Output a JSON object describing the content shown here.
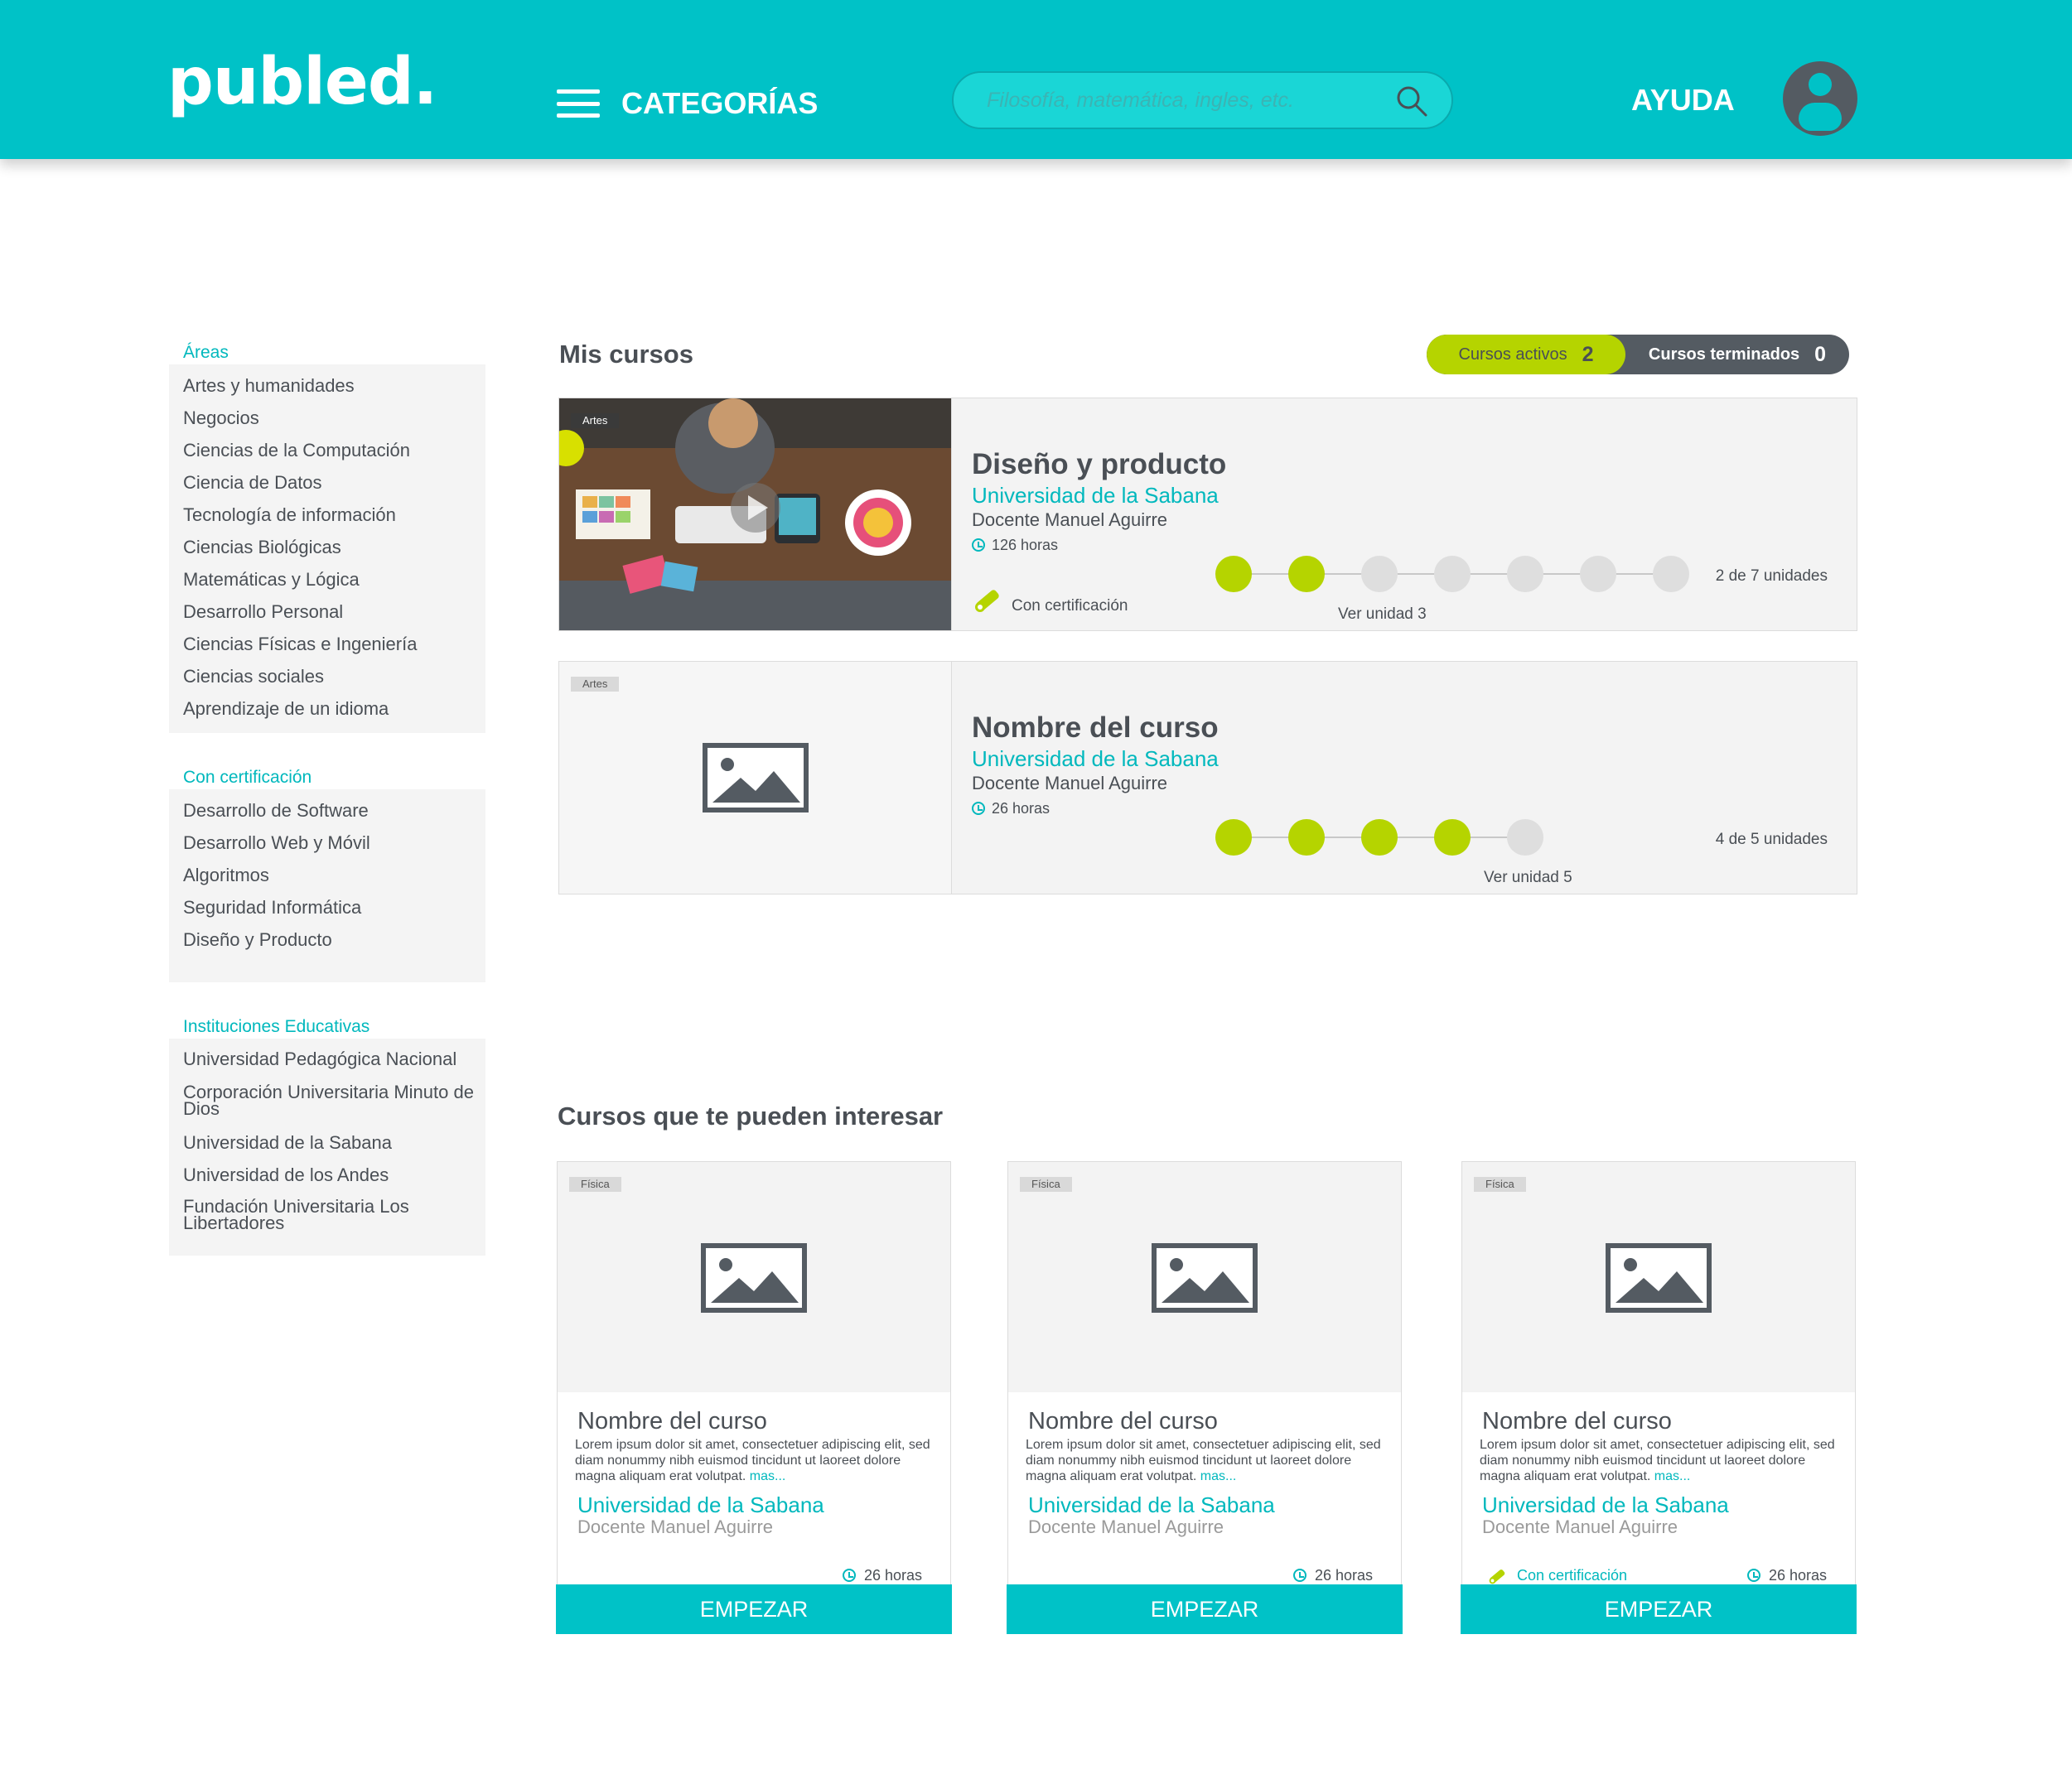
{
  "header": {
    "logo": "publed.",
    "menu_label": "CATEGORÍAS",
    "search_placeholder": "Filosofía, matemática, ingles, etc.",
    "help_label": "AYUDA"
  },
  "sidebar": {
    "groups": [
      {
        "title": "Áreas",
        "items": [
          "Artes y humanidades",
          "Negocios",
          "Ciencias de la Computación",
          "Ciencia de Datos",
          "Tecnología de información",
          "Ciencias Biológicas",
          "Matemáticas y Lógica",
          "Desarrollo Personal",
          "Ciencias Físicas e Ingeniería",
          "Ciencias sociales",
          "Aprendizaje de un idioma"
        ]
      },
      {
        "title": "Con certificación",
        "items": [
          "Desarrollo de Software",
          "Desarrollo Web y Móvil",
          "Algoritmos",
          "Seguridad Informática",
          "Diseño y Producto"
        ]
      },
      {
        "title": "Instituciones Educativas",
        "items": [
          "Universidad Pedagógica Nacional",
          "Corporación Universitaria Minuto de Dios",
          "Universidad de la Sabana",
          "Universidad de los Andes",
          "Fundación Universitaria Los Libertadores"
        ]
      }
    ]
  },
  "my_courses": {
    "title": "Mis cursos",
    "active_label": "Cursos activos",
    "active_count": "2",
    "done_label": "Cursos terminados",
    "done_count": "0",
    "courses": [
      {
        "tag": "Artes",
        "name": "Diseño y producto",
        "university": "Universidad de la Sabana",
        "teacher": "Docente Manuel Aguirre",
        "hours": "126 horas",
        "certification": "Con certificación",
        "progress": {
          "completed": 2,
          "total": 7
        },
        "units_text": "2 de 7 unidades",
        "next_unit": "Ver unidad 3"
      },
      {
        "tag": "Artes",
        "name": "Nombre del curso",
        "university": "Universidad de la Sabana",
        "teacher": "Docente Manuel Aguirre",
        "hours": "26 horas",
        "progress": {
          "completed": 4,
          "total": 5
        },
        "units_text": "4 de 5 unidades",
        "next_unit": "Ver unidad 5"
      }
    ]
  },
  "recommended": {
    "title": "Cursos que te pueden interesar",
    "cards": [
      {
        "tag": "Física",
        "name": "Nombre del curso",
        "description": "Lorem ipsum dolor sit amet, consectetuer adipiscing elit, sed diam nonummy nibh euismod tincidunt ut laoreet dolore magna aliquam erat volutpat.",
        "more": "mas...",
        "university": "Universidad de la Sabana",
        "teacher": "Docente Manuel Aguirre",
        "hours": "26 horas",
        "button": "EMPEZAR"
      },
      {
        "tag": "Física",
        "name": "Nombre del curso",
        "description": "Lorem ipsum dolor sit amet, consectetuer adipiscing elit, sed diam nonummy nibh euismod tincidunt ut laoreet dolore magna aliquam erat volutpat.",
        "more": "mas...",
        "university": "Universidad de la Sabana",
        "teacher": "Docente Manuel Aguirre",
        "hours": "26 horas",
        "button": "EMPEZAR"
      },
      {
        "tag": "Física",
        "name": "Nombre del curso",
        "description": "Lorem ipsum dolor sit amet, consectetuer adipiscing elit, sed diam nonummy nibh euismod tincidunt ut laoreet dolore magna aliquam erat volutpat.",
        "more": "mas...",
        "university": "Universidad de la Sabana",
        "teacher": "Docente Manuel Aguirre",
        "certification": "Con certificación",
        "hours": "26 horas",
        "button": "EMPEZAR"
      }
    ]
  },
  "colors": {
    "primary": "#00c2c7",
    "accent": "#b5d400",
    "dark": "#545b62",
    "text": "#4a4f55"
  },
  "icons": {
    "menu": "hamburger-icon",
    "search": "search-icon",
    "user": "user-avatar-icon",
    "clock": "clock-icon",
    "certificate": "diploma-icon",
    "image_placeholder": "image-placeholder-icon",
    "play": "play-icon"
  }
}
